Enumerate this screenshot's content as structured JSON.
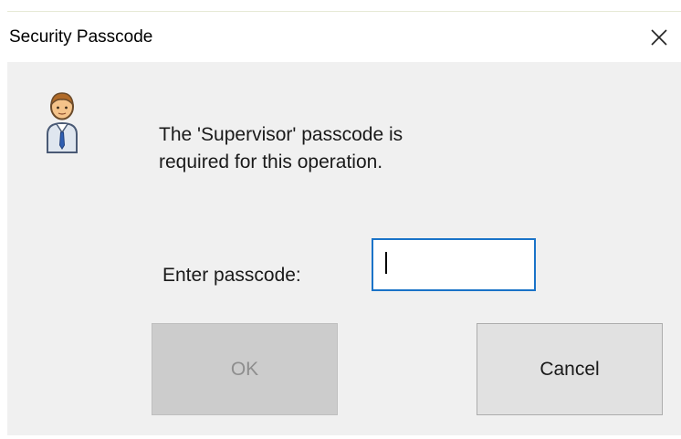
{
  "dialog": {
    "title": "Security Passcode",
    "close_icon": "close-icon",
    "user_icon": "supervisor-user-icon",
    "message_line1": "The 'Supervisor' passcode is",
    "message_line2": "required for this operation.",
    "prompt_label": "Enter passcode:",
    "passcode_value": "",
    "ok_label": "OK",
    "ok_enabled": false,
    "cancel_label": "Cancel"
  },
  "colors": {
    "dialog_bg": "#f0f0f0",
    "titlebar_bg": "#ffffff",
    "input_focus_border": "#1a73c8",
    "ok_disabled_bg": "#cccccc",
    "ok_disabled_text": "#8e8e8e",
    "cancel_bg": "#e1e1e1"
  }
}
